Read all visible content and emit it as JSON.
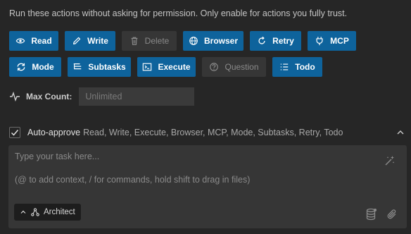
{
  "permission_text": "Run these actions without asking for permission. Only enable for actions you fully trust.",
  "buttons_row1": [
    {
      "label": "Read",
      "icon": "eye-icon",
      "enabled": true
    },
    {
      "label": "Write",
      "icon": "pencil-icon",
      "enabled": true
    },
    {
      "label": "Delete",
      "icon": "trash-icon",
      "enabled": false
    },
    {
      "label": "Browser",
      "icon": "globe-icon",
      "enabled": true
    },
    {
      "label": "Retry",
      "icon": "refresh-icon",
      "enabled": true
    },
    {
      "label": "MCP",
      "icon": "plug-icon",
      "enabled": true
    }
  ],
  "buttons_row2": [
    {
      "label": "Mode",
      "icon": "sync-icon",
      "enabled": true
    },
    {
      "label": "Subtasks",
      "icon": "list-tree-icon",
      "enabled": true
    },
    {
      "label": "Execute",
      "icon": "terminal-icon",
      "enabled": true
    },
    {
      "label": "Question",
      "icon": "question-icon",
      "enabled": false
    },
    {
      "label": "Todo",
      "icon": "checklist-icon",
      "enabled": true
    }
  ],
  "max_count": {
    "label": "Max Count:",
    "placeholder": "Unlimited",
    "value": ""
  },
  "auto_approve": {
    "label": "Auto-approve",
    "list": "Read, Write, Execute, Browser, MCP, Mode, Subtasks, Retry, Todo",
    "checked": true
  },
  "chat": {
    "placeholder_line1": "Type your task here...",
    "placeholder_line2": "(@ to add context, / for commands, hold shift to drag in files)",
    "mode_label": "Architect"
  },
  "colors": {
    "background": "#262626",
    "button_active": "#0e639c",
    "button_inactive": "#363636",
    "input_bg": "#3a3a3a",
    "chatbox_bg": "#363636"
  }
}
